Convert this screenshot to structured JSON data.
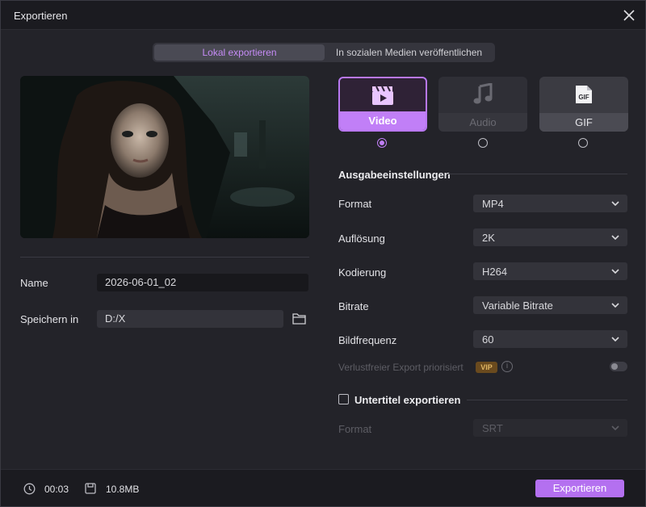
{
  "window": {
    "title": "Exportieren"
  },
  "tabs": {
    "local": "Lokal exportieren",
    "social": "In sozialen Medien veröffentlichen"
  },
  "left": {
    "name_label": "Name",
    "name_value": "2026-06-01_02",
    "save_label": "Speichern in",
    "save_value": "D:/X"
  },
  "types": {
    "video": "Video",
    "audio": "Audio",
    "gif": "GIF",
    "gif_badge": "GIF",
    "selected": "Video"
  },
  "output": {
    "title": "Ausgabeeinstellungen",
    "format_label": "Format",
    "format_value": "MP4",
    "resolution_label": "Auflösung",
    "resolution_value": "2K",
    "encoding_label": "Kodierung",
    "encoding_value": "H264",
    "bitrate_label": "Bitrate",
    "bitrate_value": "Variable Bitrate",
    "framerate_label": "Bildfrequenz",
    "framerate_value": "60",
    "lossless_label": "Verlustfreier Export priorisiert",
    "vip": "VIP",
    "info": "i"
  },
  "subtitles": {
    "title": "Untertitel exportieren",
    "format_label": "Format",
    "format_value": "SRT"
  },
  "footer": {
    "duration": "00:03",
    "size": "10.8MB",
    "export": "Exportieren"
  },
  "colors": {
    "accent": "#c17ff7",
    "button": "#b470f0",
    "background": "#232329"
  }
}
